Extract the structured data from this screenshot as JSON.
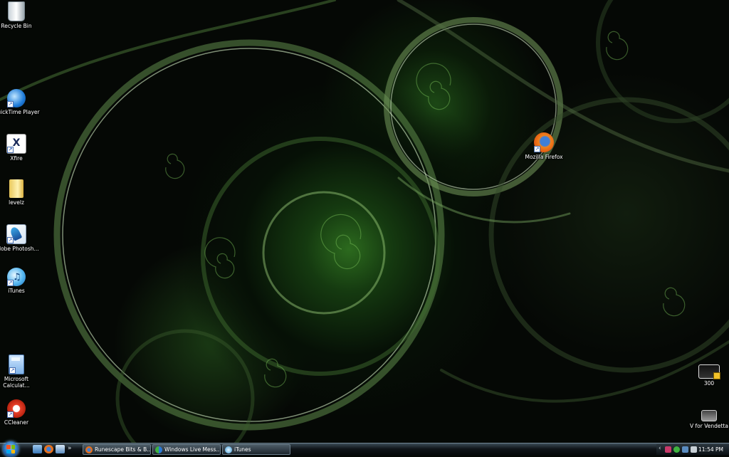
{
  "desktop": {
    "icons_left": [
      {
        "label": "Recycle Bin",
        "icon": "recycle-bin-icon"
      },
      {
        "label": "QuickTime Player",
        "icon": "quicktime-icon"
      },
      {
        "label": "Xfire",
        "icon": "xfire-icon"
      },
      {
        "label": "levelz",
        "icon": "folder-icon"
      },
      {
        "label": "Adobe Photosh...",
        "icon": "photoshop-icon"
      },
      {
        "label": "iTunes",
        "icon": "itunes-icon"
      },
      {
        "label": "Microsoft Calculat...",
        "icon": "calculator-icon"
      },
      {
        "label": "CCleaner",
        "icon": "ccleaner-icon"
      }
    ],
    "firefox": {
      "label": "Mozilla Firefox",
      "icon": "firefox-icon"
    },
    "icons_right": [
      {
        "label": "300",
        "icon": "video-file-icon"
      },
      {
        "label": "V for Vendetta",
        "icon": "video-file-icon"
      }
    ]
  },
  "taskbar": {
    "quick_launch_more": "»",
    "buttons": [
      {
        "label": "Runescape Bits & B...",
        "icon": "firefox-icon"
      },
      {
        "label": "Windows Live Mess...",
        "icon": "messenger-icon"
      },
      {
        "label": "iTunes",
        "icon": "itunes-icon"
      }
    ],
    "clock": "11:54 PM"
  },
  "colors": {
    "wallpaper_accent": "#3fa02a",
    "taskbar": "#0f1418"
  }
}
